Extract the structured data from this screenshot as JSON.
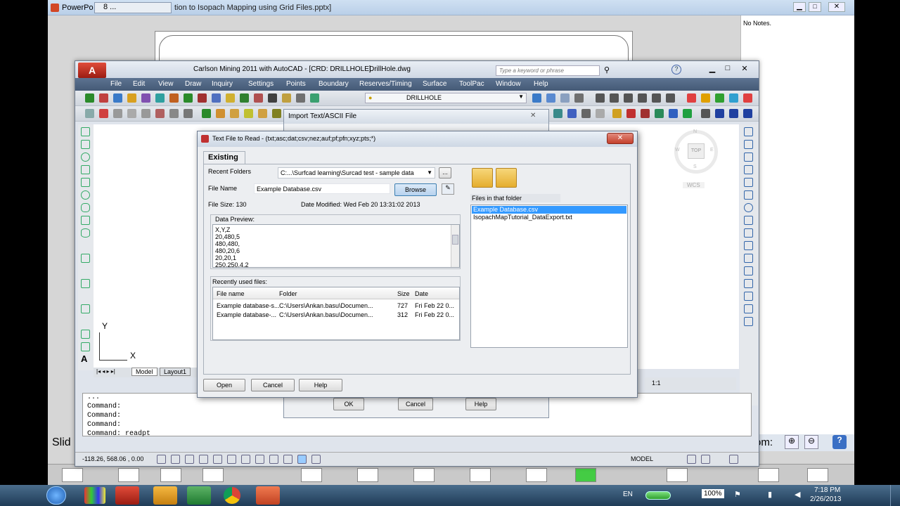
{
  "powerpoint": {
    "app_label": "PowerPo",
    "window_label": "8 ...",
    "title": "tion to Isopach Mapping using Grid Files.pptx]",
    "notes": "No Notes.",
    "slide_label": "Slid",
    "zoom_label": "om:"
  },
  "acad": {
    "title": "Carlson Mining 2011 with AutoCAD - [CRD: DRILLHOLE]",
    "doc": "DrillHole.dwg",
    "search_placeholder": "Type a keyword or phrase",
    "menu": [
      "Edit",
      "View",
      "Draw",
      "Inquiry",
      "Settings",
      "Points",
      "Boundary",
      "Reserves/Timing",
      "Surface",
      "ToolPac",
      "Window",
      "Help"
    ],
    "file_menu": "File",
    "layer": "DRILLHOLE",
    "layout_tabs": [
      "Model",
      "Layout1"
    ],
    "viewcube": {
      "top": "TOP",
      "n": "N",
      "s": "S",
      "e": "E",
      "w": "W",
      "wcs": "WCS"
    },
    "axis_x": "X",
    "axis_y": "Y",
    "command_lines": [
      "...",
      "Command:",
      "Command:",
      "Command:",
      "Command: readpt"
    ],
    "coords": "-118.26, 568.06 , 0.00",
    "status_model": "MODEL",
    "scale": "1:1"
  },
  "import_dialog": {
    "title": "Import Text/ASCII File",
    "ok": "OK",
    "cancel": "Cancel",
    "help": "Help"
  },
  "dialog": {
    "title": "Text File to Read - (txt;asc;dat;csv;nez;auf;pf;pfn;xyz;pts;*)",
    "tab": "Existing",
    "recent_folders_label": "Recent Folders",
    "recent_folder_value": "C:...\\Surfcad learning\\Surcad test - sample data",
    "browse_more": "...",
    "file_name_label": "File Name",
    "file_name_value": "Example Database.csv",
    "browse": "Browse",
    "file_size": "File Size: 130",
    "date_modified": "Date Modified: Wed Feb 20 13:31:02 2013",
    "preview_label": "Data Preview:",
    "preview_lines": [
      "X,Y,Z",
      "20,480,5",
      "480,480,",
      "480,20,6",
      "20,20,1",
      "250,250,4.2"
    ],
    "recent_files_label": "Recently used files:",
    "recent_columns": [
      "File name",
      "Folder",
      "Size",
      "Date"
    ],
    "recent_rows": [
      {
        "name": "Example database-s...",
        "folder": "C:\\Users\\Ankan.basu\\Documen...",
        "size": "727",
        "date": "Fri Feb 22 0..."
      },
      {
        "name": "Example database-...",
        "folder": "C:\\Users\\Ankan.basu\\Documen...",
        "size": "312",
        "date": "Fri Feb 22 0..."
      }
    ],
    "files_label": "Files in that folder",
    "files": [
      "Example Database.csv",
      "IsopachMapTutorial_DataExport.txt"
    ],
    "open": "Open",
    "cancel": "Cancel",
    "help": "Help"
  },
  "taskbar": {
    "lang": "EN",
    "battery": "100%",
    "time": "7:18 PM",
    "date": "2/26/2013"
  },
  "colors": {
    "accent": "#3399ff",
    "menu_bar": "#4f6684"
  }
}
